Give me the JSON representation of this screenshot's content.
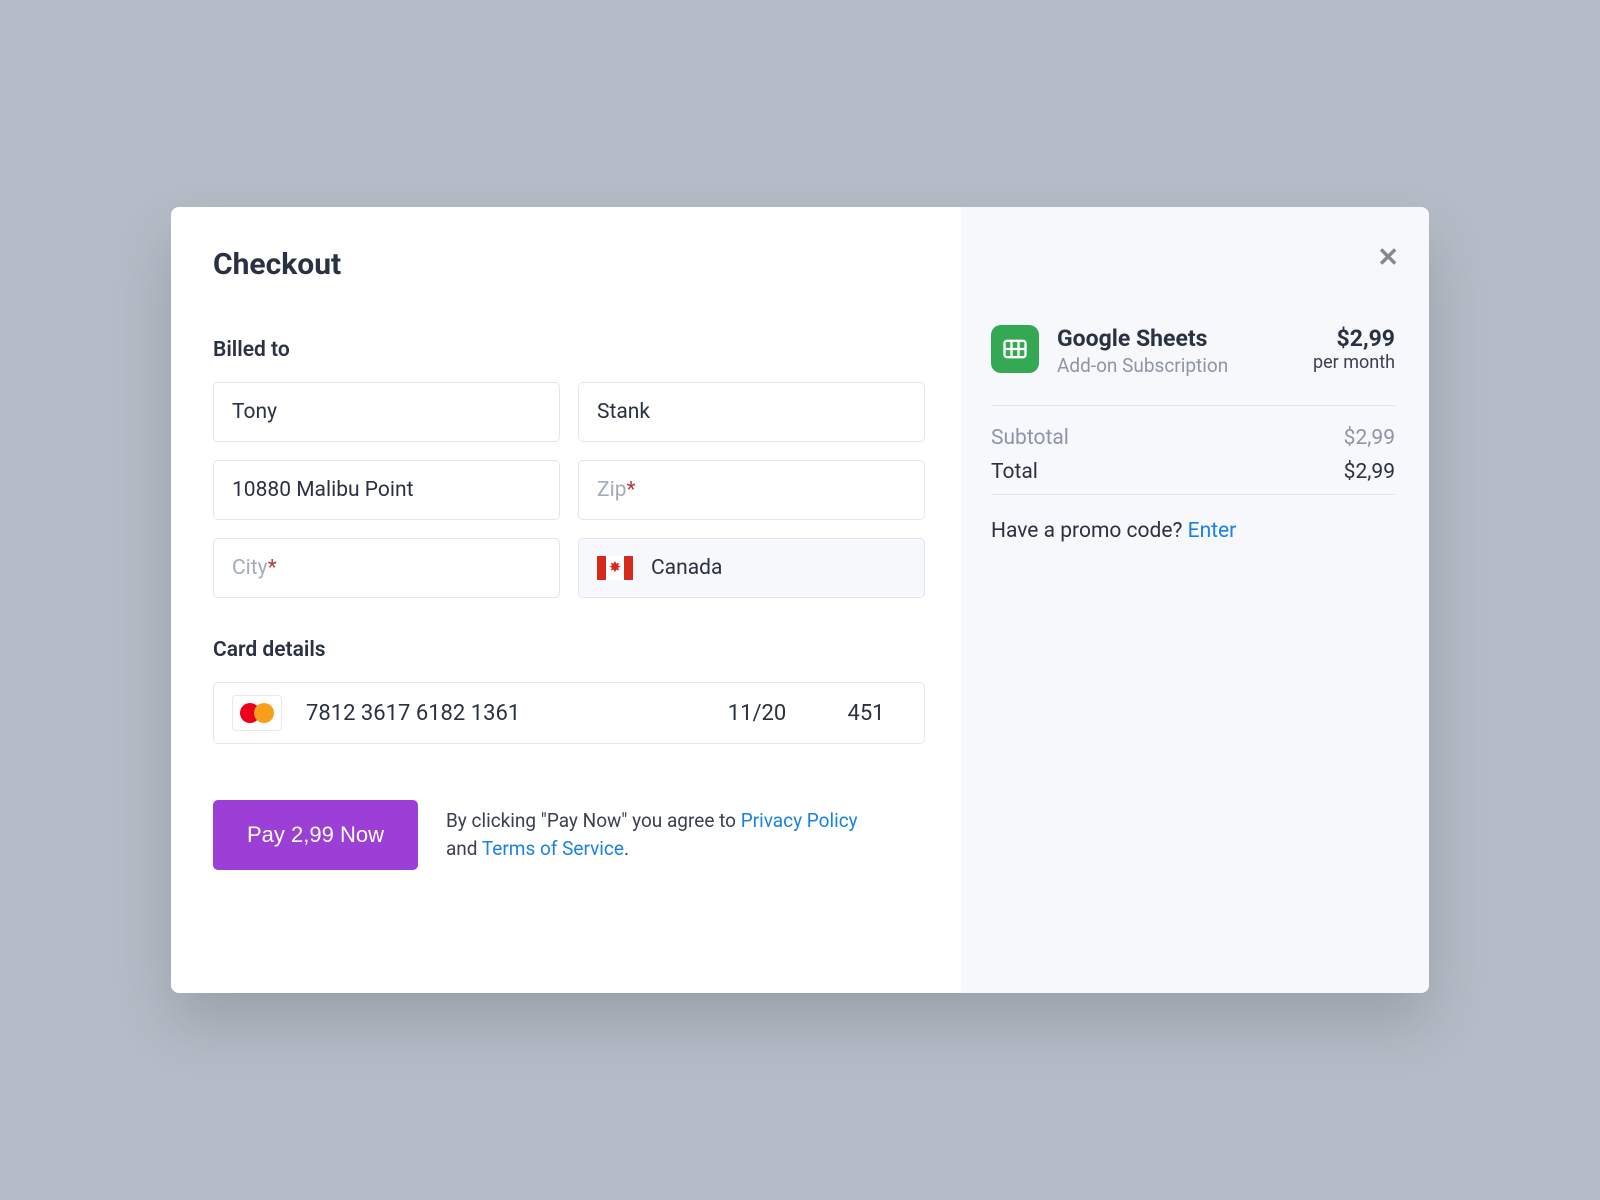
{
  "title": "Checkout",
  "sections": {
    "billed_to": "Billed to",
    "card_details": "Card details"
  },
  "billing": {
    "first_name": "Tony",
    "last_name": "Stank",
    "address": "10880 Malibu Point",
    "zip_placeholder": "Zip",
    "city_placeholder": "City",
    "country": "Canada"
  },
  "card": {
    "number": "7812 3617 6182 1361",
    "expiry": "11/20",
    "cvv": "451"
  },
  "actions": {
    "pay_button": "Pay 2,99 Now"
  },
  "agreement": {
    "pre": "By clicking \"Pay Now\" you agree to ",
    "link1": "Privacy Policy",
    "mid": " and ",
    "link2": "Terms of Service",
    "post": "."
  },
  "summary": {
    "product_name": "Google Sheets",
    "product_sub": "Add-on Subscription",
    "price": "$2,99",
    "period": "per month",
    "subtotal_label": "Subtotal",
    "subtotal_value": "$2,99",
    "total_label": "Total",
    "total_value": "$2,99",
    "promo_text": "Have a promo code? ",
    "promo_link": "Enter"
  }
}
